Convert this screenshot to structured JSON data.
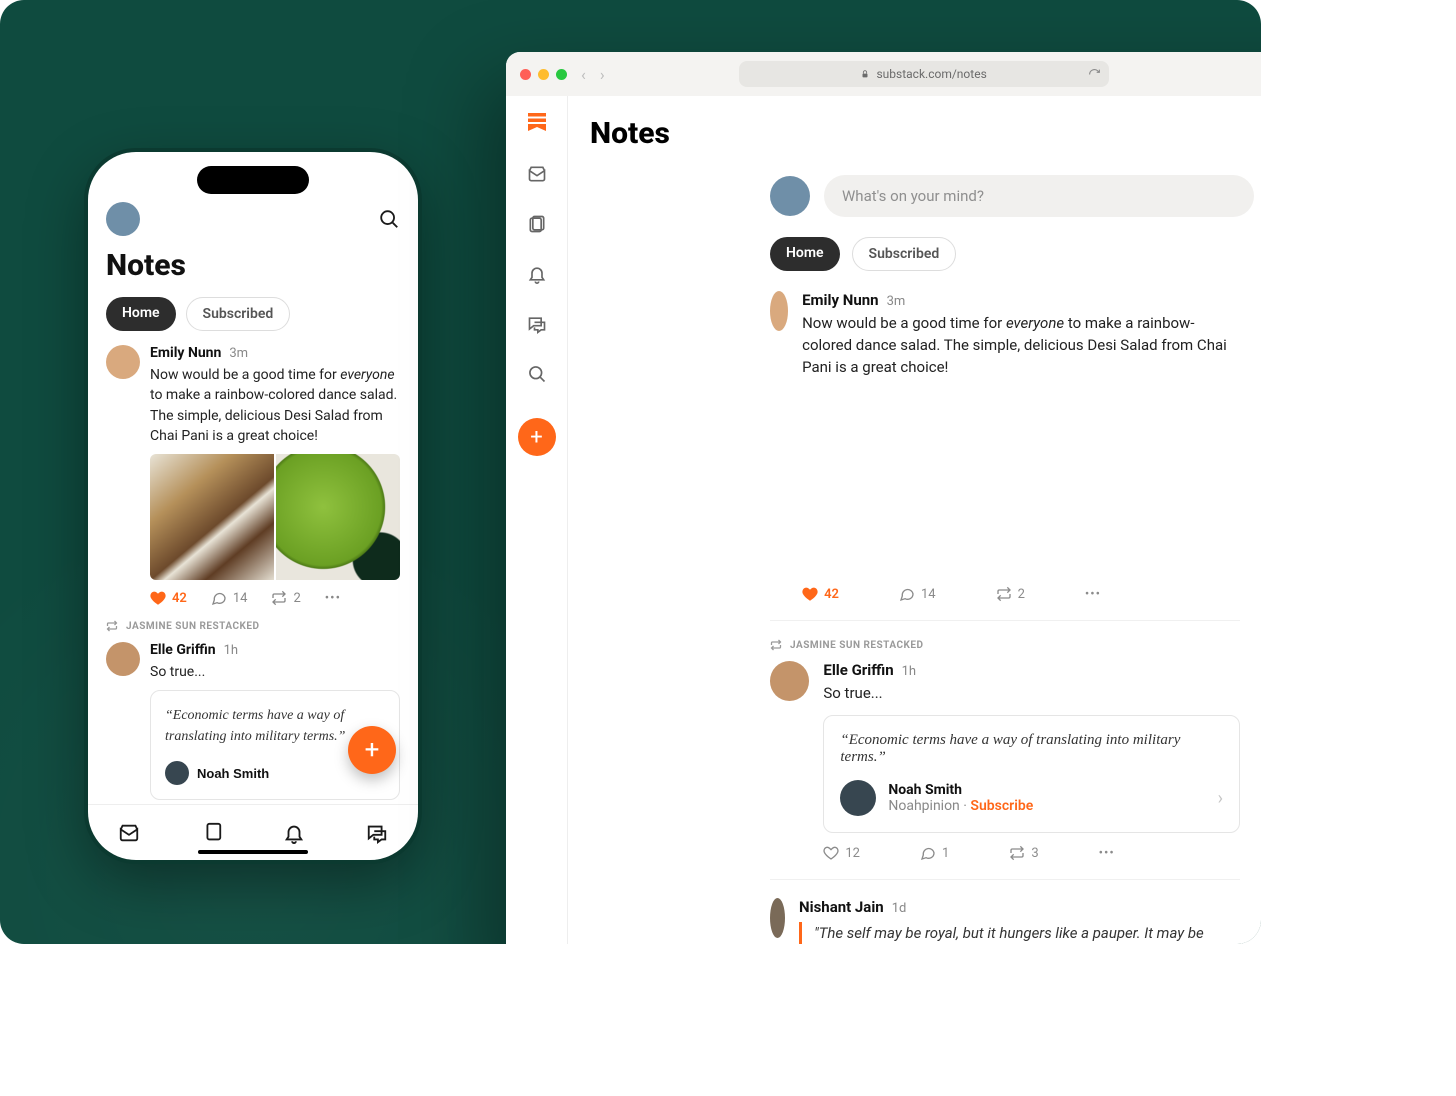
{
  "page_title": "Notes",
  "tabs": {
    "home": "Home",
    "subscribed": "Subscribed"
  },
  "browser": {
    "url": "substack.com/notes",
    "compose_placeholder": "What's on your mind?"
  },
  "sidebar_icons": [
    "logo",
    "inbox",
    "notes",
    "notifications",
    "chat",
    "search",
    "compose"
  ],
  "phone_tabbar_icons": [
    "inbox",
    "notes",
    "notifications",
    "chat"
  ],
  "posts": [
    {
      "author": "Emily Nunn",
      "time": "3m",
      "body_prefix": "Now would be a good time for ",
      "body_em": "everyone",
      "body_suffix_phone": " to make a rainbow-colored dance salad. The simple, delicious Desi Salad from Chai Pani is a great choice!",
      "body_suffix_desktop": " to make a rainbow-colored dance salad. The simple, delicious Desi Salad from Chai Pani is a great choice!",
      "likes": "42",
      "comments": "14",
      "restacks": "2"
    },
    {
      "restacked_by": "JASMINE SUN RESTACKED",
      "author": "Elle Griffin",
      "time": "1h",
      "body": "So true...",
      "quote": "“Economic terms have a way of translating into military terms.”",
      "embed_author": "Noah Smith",
      "embed_pub": "Noahpinion",
      "embed_cta": "Subscribe",
      "likes": "12",
      "comments": "1",
      "restacks": "3"
    },
    {
      "author": "Nishant Jain",
      "time": "1d",
      "quote_body": "\"The self may be royal, but it hungers like a pauper. It may be nourished for a moment by the inspection of such cocooned wonders as these, but it remains a poor, starving, thirsting"
    }
  ]
}
